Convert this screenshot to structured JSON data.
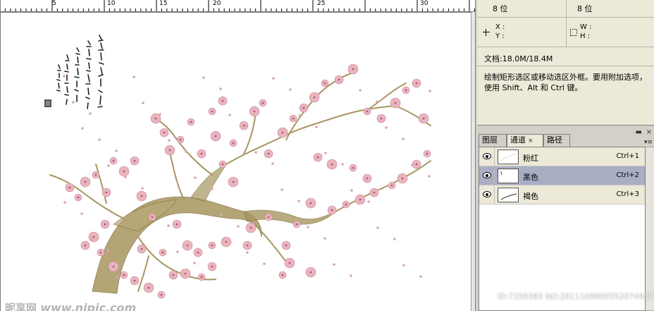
{
  "ruler": {
    "ticks": [
      "5",
      "10",
      "15",
      "20",
      "25",
      "30"
    ]
  },
  "canvas": {
    "calligraphy_icon": "calligraphy-seal-text",
    "blossom_color": "#e8b4bf",
    "branch_color": "#a89660"
  },
  "watermark": {
    "brand": "昵享网",
    "url": "www.nipic.com"
  },
  "info": {
    "bits_left": "8 位",
    "bits_right": "8 位",
    "x_label": "X :",
    "y_label": "Y :",
    "w_label": "W :",
    "h_label": "H :",
    "doc_size": "文档:18.0M/18.4M",
    "hint": "绘制矩形选区或移动选区外框。要用附加选项，使用 Shift、Alt 和 Ctrl 键。"
  },
  "panel": {
    "tabs": [
      {
        "label": "图层"
      },
      {
        "label": "通道",
        "close": "×"
      },
      {
        "label": "路径"
      }
    ],
    "close_glyph": "×",
    "minimize_glyph": "▬",
    "menu_glyph": "▾≡"
  },
  "channels": [
    {
      "name": "粉红",
      "shortcut": "Ctrl+1",
      "selected": false
    },
    {
      "name": "黑色",
      "shortcut": "Ctrl+2",
      "selected": true
    },
    {
      "name": "褐色",
      "shortcut": "Ctrl+3",
      "selected": false
    }
  ],
  "id_watermark": "ID:7350393 NO:20111008095520749877"
}
